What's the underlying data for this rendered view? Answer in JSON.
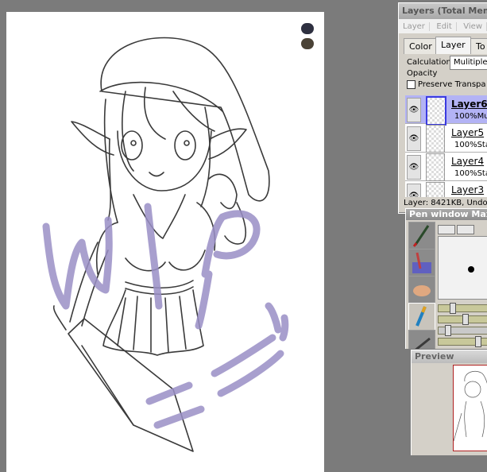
{
  "colors": {
    "swatch_primary": "#2e3040",
    "swatch_secondary": "#4a4236",
    "canvas_bg": "#ffffff",
    "workspace_bg": "#7b7b7b",
    "selected_layer": "#b3b3f5",
    "lineart": "#3a3a3a",
    "wip_paint": "#9a8fc6"
  },
  "canvas": {
    "wip_overlay": "WIP =v="
  },
  "layers_panel": {
    "title": "Layers (Total Mem",
    "menu": [
      "Layer",
      "Edit",
      "View"
    ],
    "tabs": [
      "Color",
      "Layer",
      "To"
    ],
    "active_tab": "Layer",
    "calculation_label": "Calculation",
    "calculation_value": "Mulitiple",
    "opacity_label": "Opacity",
    "preserve_label": "Preserve Transpa",
    "layers": [
      {
        "name": "Layer6",
        "mode": "100%Mu",
        "selected": true
      },
      {
        "name": "Layer5",
        "mode": "100%Sta",
        "selected": false
      },
      {
        "name": "Layer4",
        "mode": "100%Sta",
        "selected": false
      },
      {
        "name": "Layer3",
        "mode": "",
        "selected": false
      }
    ],
    "status": "Layer: 8421KB, Undo"
  },
  "pen_window": {
    "title": "Pen window  Maxi",
    "tools": [
      "pen-icon",
      "brush-icon",
      "finger-icon",
      "marker-icon",
      "eraser-icon"
    ]
  },
  "preview": {
    "title": "Preview"
  }
}
